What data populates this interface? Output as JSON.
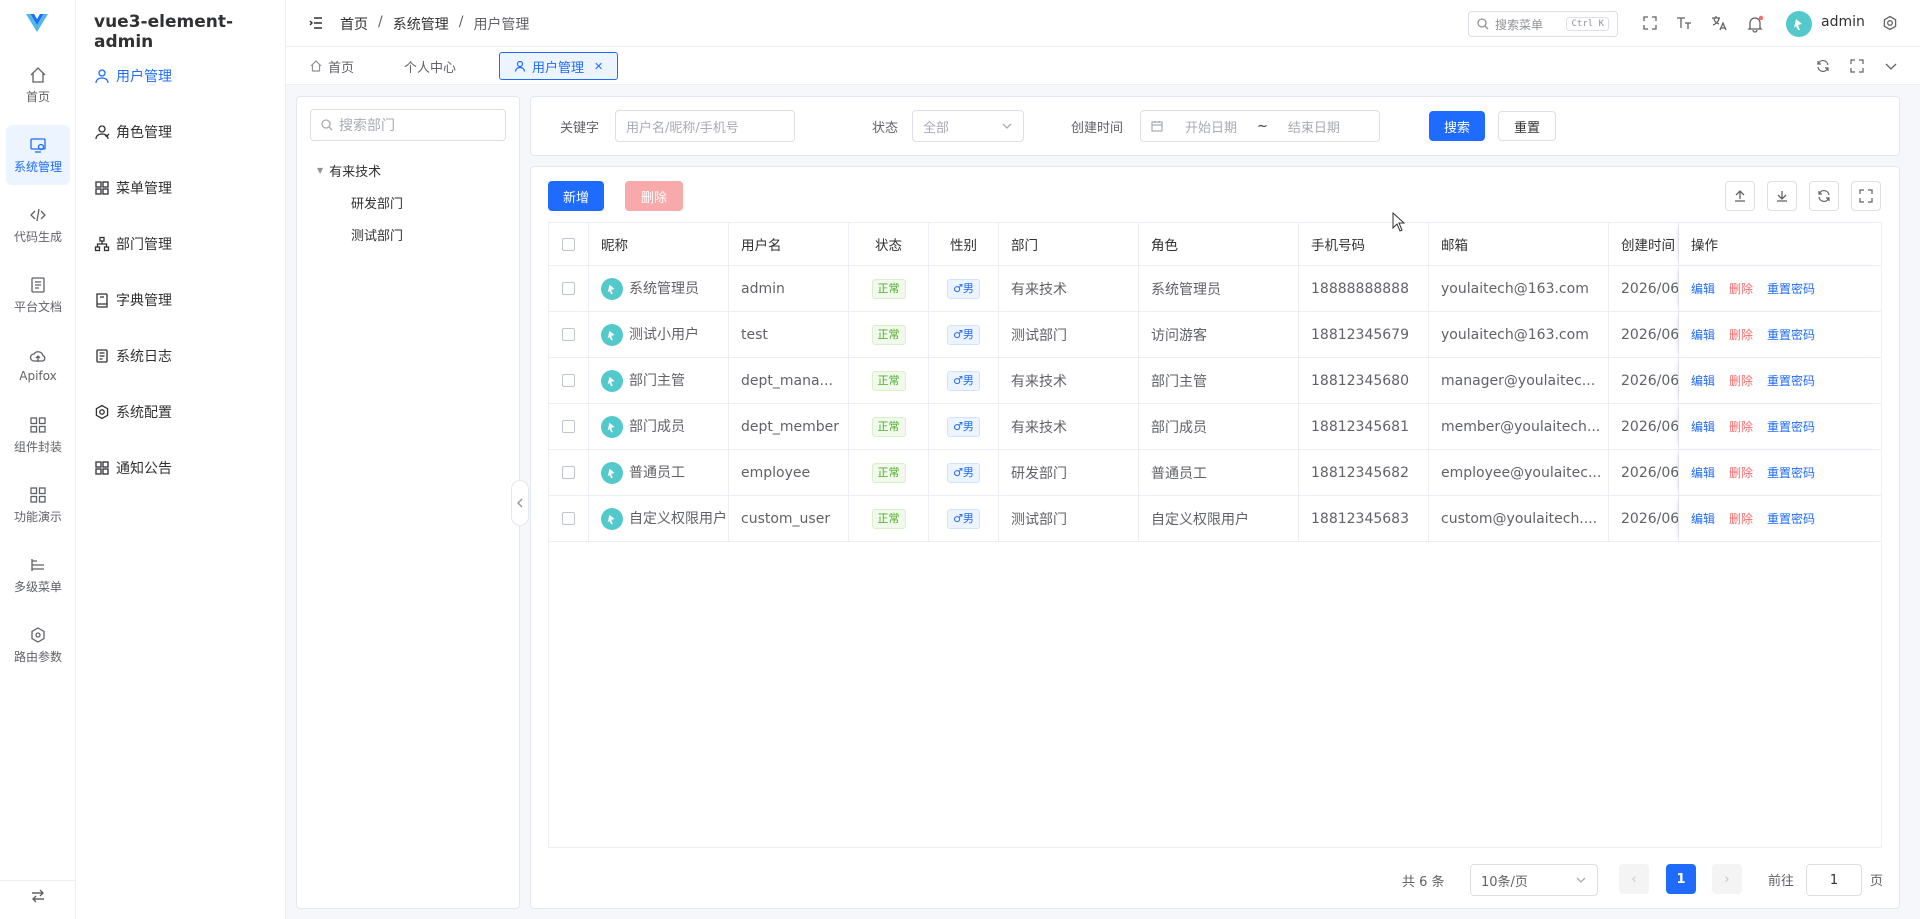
{
  "app": {
    "title": "vue3-element-admin"
  },
  "rail": {
    "items": [
      {
        "label": "首页",
        "icon": "home-icon"
      },
      {
        "label": "系统管理",
        "icon": "system-icon"
      },
      {
        "label": "代码生成",
        "icon": "code-icon"
      },
      {
        "label": "平台文档",
        "icon": "document-icon"
      },
      {
        "label": "Apifox",
        "icon": "cloud-icon"
      },
      {
        "label": "组件封装",
        "icon": "grid-icon"
      },
      {
        "label": "功能演示",
        "icon": "grid-icon"
      },
      {
        "label": "多级菜单",
        "icon": "list-icon"
      },
      {
        "label": "路由参数",
        "icon": "route-icon"
      }
    ],
    "active_index": 1
  },
  "submenu": {
    "items": [
      {
        "label": "用户管理",
        "icon": "user-icon"
      },
      {
        "label": "角色管理",
        "icon": "role-icon"
      },
      {
        "label": "菜单管理",
        "icon": "menu-icon"
      },
      {
        "label": "部门管理",
        "icon": "tree-icon"
      },
      {
        "label": "字典管理",
        "icon": "dict-icon"
      },
      {
        "label": "系统日志",
        "icon": "log-icon"
      },
      {
        "label": "系统配置",
        "icon": "settings-icon"
      },
      {
        "label": "通知公告",
        "icon": "notice-icon"
      }
    ],
    "active_index": 0
  },
  "header": {
    "breadcrumb": [
      "首页",
      "系统管理",
      "用户管理"
    ],
    "search_placeholder": "搜索菜单",
    "search_shortcut": "Ctrl K",
    "user": "admin"
  },
  "tags": [
    {
      "label": "首页"
    },
    {
      "label": "个人中心"
    },
    {
      "label": "用户管理"
    }
  ],
  "dept": {
    "search_placeholder": "搜索部门",
    "root": "有来技术",
    "children": [
      "研发部门",
      "测试部门"
    ]
  },
  "filters": {
    "keyword_label": "关键字",
    "keyword_placeholder": "用户名/昵称/手机号",
    "status_label": "状态",
    "status_value": "全部",
    "time_label": "创建时间",
    "start_placeholder": "开始日期",
    "range_sep": "~",
    "end_placeholder": "结束日期",
    "search_btn": "搜索",
    "reset_btn": "重置"
  },
  "toolbar": {
    "add_btn": "新增",
    "delete_btn": "删除"
  },
  "table": {
    "columns": [
      "昵称",
      "用户名",
      "状态",
      "性别",
      "部门",
      "角色",
      "手机号码",
      "邮箱",
      "创建时间",
      "操作"
    ],
    "rows": [
      {
        "nickname": "系统管理员",
        "username": "admin",
        "status": "正常",
        "gender": "♂男",
        "dept": "有来技术",
        "role": "系统管理员",
        "phone": "18888888888",
        "email": "youlaitech@163.com",
        "created": "2026/06/"
      },
      {
        "nickname": "测试小用户",
        "username": "test",
        "status": "正常",
        "gender": "♂男",
        "dept": "测试部门",
        "role": "访问游客",
        "phone": "18812345679",
        "email": "youlaitech@163.com",
        "created": "2026/06/"
      },
      {
        "nickname": "部门主管",
        "username": "dept_mana...",
        "status": "正常",
        "gender": "♂男",
        "dept": "有来技术",
        "role": "部门主管",
        "phone": "18812345680",
        "email": "manager@youlaitec...",
        "created": "2026/06/"
      },
      {
        "nickname": "部门成员",
        "username": "dept_member",
        "status": "正常",
        "gender": "♂男",
        "dept": "有来技术",
        "role": "部门成员",
        "phone": "18812345681",
        "email": "member@youlaitech...",
        "created": "2026/06/"
      },
      {
        "nickname": "普通员工",
        "username": "employee",
        "status": "正常",
        "gender": "♂男",
        "dept": "研发部门",
        "role": "普通员工",
        "phone": "18812345682",
        "email": "employee@youlaitec...",
        "created": "2026/06/"
      },
      {
        "nickname": "自定义权限用户",
        "username": "custom_user",
        "status": "正常",
        "gender": "♂男",
        "dept": "测试部门",
        "role": "自定义权限用户",
        "phone": "18812345683",
        "email": "custom@youlaitech....",
        "created": "2026/06/"
      }
    ],
    "ops": {
      "edit": "编辑",
      "delete": "删除",
      "reset": "重置密码"
    }
  },
  "pagination": {
    "total_text": "共 6 条",
    "page_size": "10条/页",
    "current_page": "1",
    "goto_label": "前往",
    "goto_value": "1",
    "page_suffix": "页"
  },
  "colors": {
    "primary": "#1f6bfe",
    "danger": "#f56c6c",
    "success": "#4cae28",
    "avatar": "#53c9cb"
  }
}
